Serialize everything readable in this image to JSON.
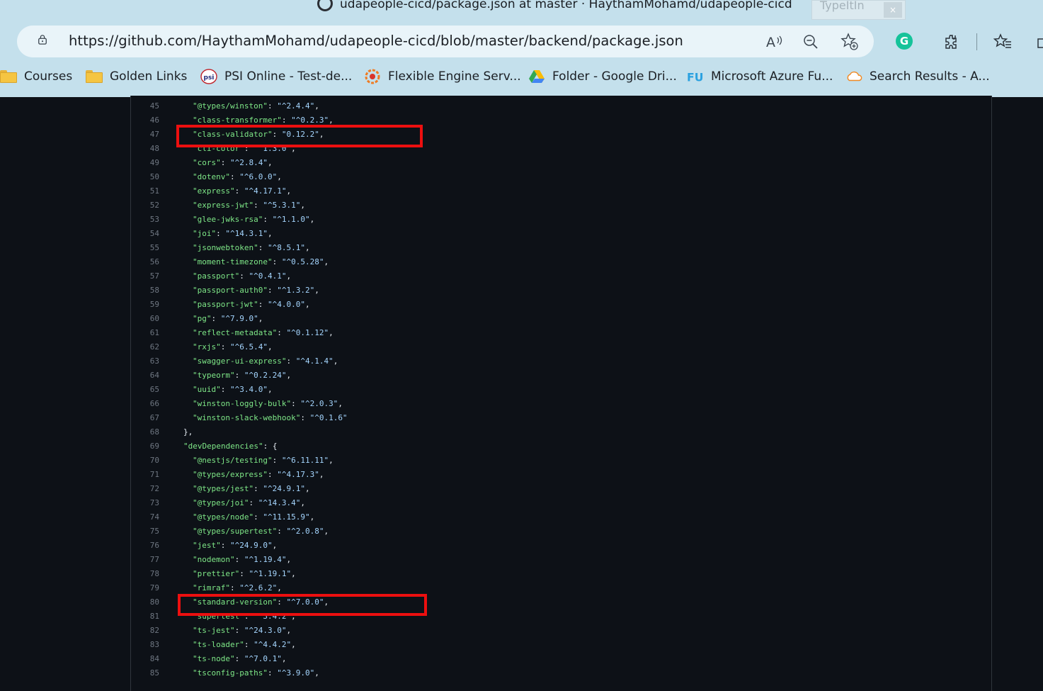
{
  "window": {
    "title": "udapeople-cicd/package.json at master · HaythamMohamd/udapeople-cicd"
  },
  "typeit_panel": {
    "label": "TypeItIn",
    "close": "×"
  },
  "address_bar": {
    "url": "https://github.com/HaythamMohamd/udapeople-cicd/blob/master/backend/package.json"
  },
  "toolbar": {
    "grammarly_label": "G"
  },
  "bookmarks": [
    {
      "label": "Courses",
      "icon": "folder-icon"
    },
    {
      "label": "Golden Links",
      "icon": "folder-icon"
    },
    {
      "label": "PSI Online - Test-de...",
      "icon": "psi-icon"
    },
    {
      "label": "Flexible Engine Serv...",
      "icon": "flexible-engine-icon"
    },
    {
      "label": "Folder - Google Dri...",
      "icon": "google-drive-icon"
    },
    {
      "label": "Microsoft Azure Fu...",
      "icon": "azure-icon"
    },
    {
      "label": "Search Results - A...",
      "icon": "cloud-icon"
    }
  ],
  "code_lines": [
    {
      "n": "45",
      "key": "\"@types/winston\"",
      "val": "\"^2.4.4\"",
      "end": ","
    },
    {
      "n": "46",
      "key": "\"class-transformer\"",
      "val": "\"^0.2.3\"",
      "end": ","
    },
    {
      "n": "47",
      "key": "\"class-validator\"",
      "val": "\"0.12.2\"",
      "end": ","
    },
    {
      "n": "48",
      "key": "\"cli-color\"",
      "val": "\"^1.3.0\"",
      "end": ","
    },
    {
      "n": "49",
      "key": "\"cors\"",
      "val": "\"^2.8.4\"",
      "end": ","
    },
    {
      "n": "50",
      "key": "\"dotenv\"",
      "val": "\"^6.0.0\"",
      "end": ","
    },
    {
      "n": "51",
      "key": "\"express\"",
      "val": "\"^4.17.1\"",
      "end": ","
    },
    {
      "n": "52",
      "key": "\"express-jwt\"",
      "val": "\"^5.3.1\"",
      "end": ","
    },
    {
      "n": "53",
      "key": "\"glee-jwks-rsa\"",
      "val": "\"^1.1.0\"",
      "end": ","
    },
    {
      "n": "54",
      "key": "\"joi\"",
      "val": "\"^14.3.1\"",
      "end": ","
    },
    {
      "n": "55",
      "key": "\"jsonwebtoken\"",
      "val": "\"^8.5.1\"",
      "end": ","
    },
    {
      "n": "56",
      "key": "\"moment-timezone\"",
      "val": "\"^0.5.28\"",
      "end": ","
    },
    {
      "n": "57",
      "key": "\"passport\"",
      "val": "\"^0.4.1\"",
      "end": ","
    },
    {
      "n": "58",
      "key": "\"passport-auth0\"",
      "val": "\"^1.3.2\"",
      "end": ","
    },
    {
      "n": "59",
      "key": "\"passport-jwt\"",
      "val": "\"^4.0.0\"",
      "end": ","
    },
    {
      "n": "60",
      "key": "\"pg\"",
      "val": "\"^7.9.0\"",
      "end": ","
    },
    {
      "n": "61",
      "key": "\"reflect-metadata\"",
      "val": "\"^0.1.12\"",
      "end": ","
    },
    {
      "n": "62",
      "key": "\"rxjs\"",
      "val": "\"^6.5.4\"",
      "end": ","
    },
    {
      "n": "63",
      "key": "\"swagger-ui-express\"",
      "val": "\"^4.1.4\"",
      "end": ","
    },
    {
      "n": "64",
      "key": "\"typeorm\"",
      "val": "\"^0.2.24\"",
      "end": ","
    },
    {
      "n": "65",
      "key": "\"uuid\"",
      "val": "\"^3.4.0\"",
      "end": ","
    },
    {
      "n": "66",
      "key": "\"winston-loggly-bulk\"",
      "val": "\"^2.0.3\"",
      "end": ","
    },
    {
      "n": "67",
      "key": "\"winston-slack-webhook\"",
      "val": "\"^0.1.6\"",
      "end": ""
    },
    {
      "n": "68",
      "plain": "},",
      "indent": 1
    },
    {
      "n": "69",
      "key": "\"devDependencies\"",
      "val": "",
      "end": "{",
      "indent": 1
    },
    {
      "n": "70",
      "key": "\"@nestjs/testing\"",
      "val": "\"^6.11.11\"",
      "end": ","
    },
    {
      "n": "71",
      "key": "\"@types/express\"",
      "val": "\"^4.17.3\"",
      "end": ","
    },
    {
      "n": "72",
      "key": "\"@types/jest\"",
      "val": "\"^24.9.1\"",
      "end": ","
    },
    {
      "n": "73",
      "key": "\"@types/joi\"",
      "val": "\"^14.3.4\"",
      "end": ","
    },
    {
      "n": "74",
      "key": "\"@types/node\"",
      "val": "\"^11.15.9\"",
      "end": ","
    },
    {
      "n": "75",
      "key": "\"@types/supertest\"",
      "val": "\"^2.0.8\"",
      "end": ","
    },
    {
      "n": "76",
      "key": "\"jest\"",
      "val": "\"^24.9.0\"",
      "end": ","
    },
    {
      "n": "77",
      "key": "\"nodemon\"",
      "val": "\"^1.19.4\"",
      "end": ","
    },
    {
      "n": "78",
      "key": "\"prettier\"",
      "val": "\"^1.19.1\"",
      "end": ","
    },
    {
      "n": "79",
      "key": "\"rimraf\"",
      "val": "\"^2.6.2\"",
      "end": ","
    },
    {
      "n": "80",
      "key": "\"standard-version\"",
      "val": "\"^7.0.0\"",
      "end": ","
    },
    {
      "n": "81",
      "key": "\"supertest\"",
      "val": "\"^3.4.2\"",
      "end": ","
    },
    {
      "n": "82",
      "key": "\"ts-jest\"",
      "val": "\"^24.3.0\"",
      "end": ","
    },
    {
      "n": "83",
      "key": "\"ts-loader\"",
      "val": "\"^4.4.2\"",
      "end": ","
    },
    {
      "n": "84",
      "key": "\"ts-node\"",
      "val": "\"^7.0.1\"",
      "end": ","
    },
    {
      "n": "85",
      "key": "\"tsconfig-paths\"",
      "val": "\"^3.9.0\"",
      "end": ","
    }
  ],
  "highlighted_lines": [
    "47",
    "80"
  ],
  "colors": {
    "chrome": "#c4e0ec",
    "code_bg": "#0d1117",
    "json_key": "#7ee787",
    "json_string": "#a5d6ff",
    "highlight_box": "#ec0f0f"
  }
}
